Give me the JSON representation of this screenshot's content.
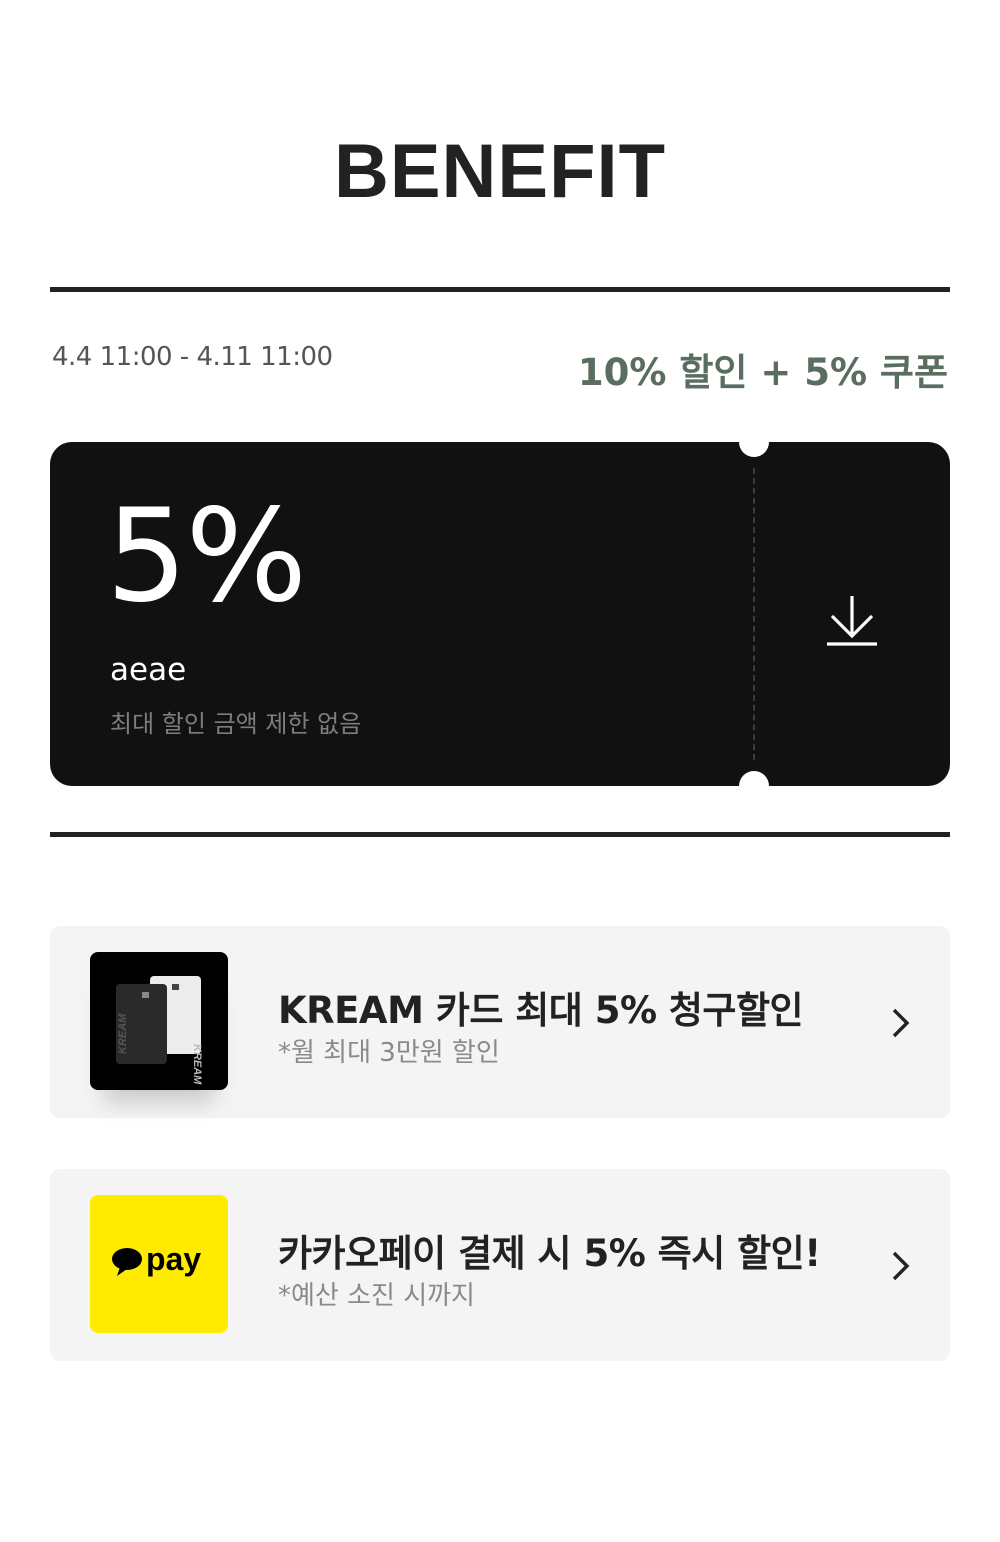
{
  "page": {
    "title": "BENEFIT"
  },
  "event": {
    "period": "4.4 11:00 - 4.11 11:00",
    "headline": "10% 할인 + 5% 쿠폰"
  },
  "coupon": {
    "percent": "5%",
    "name": "aeae",
    "limit": "최대 할인 금액 제한 없음",
    "download_icon": "download-icon"
  },
  "benefits": [
    {
      "title": "KREAM 카드 최대 5% 청구할인",
      "subtitle": "*월 최대 3만원 할인",
      "image": "kream-card-image",
      "card_text": "KREAM"
    },
    {
      "title": "카카오페이 결제 시 5% 즉시 할인!",
      "subtitle": "*예산 소진 시까지",
      "image": "kakaopay-logo",
      "logo_text": "pay",
      "accent": "#ffeb00"
    }
  ],
  "colors": {
    "headline": "#5a6e60",
    "coupon_bg": "#111111",
    "card_bg": "#f4f4f4",
    "kakao_yellow": "#ffeb00"
  }
}
